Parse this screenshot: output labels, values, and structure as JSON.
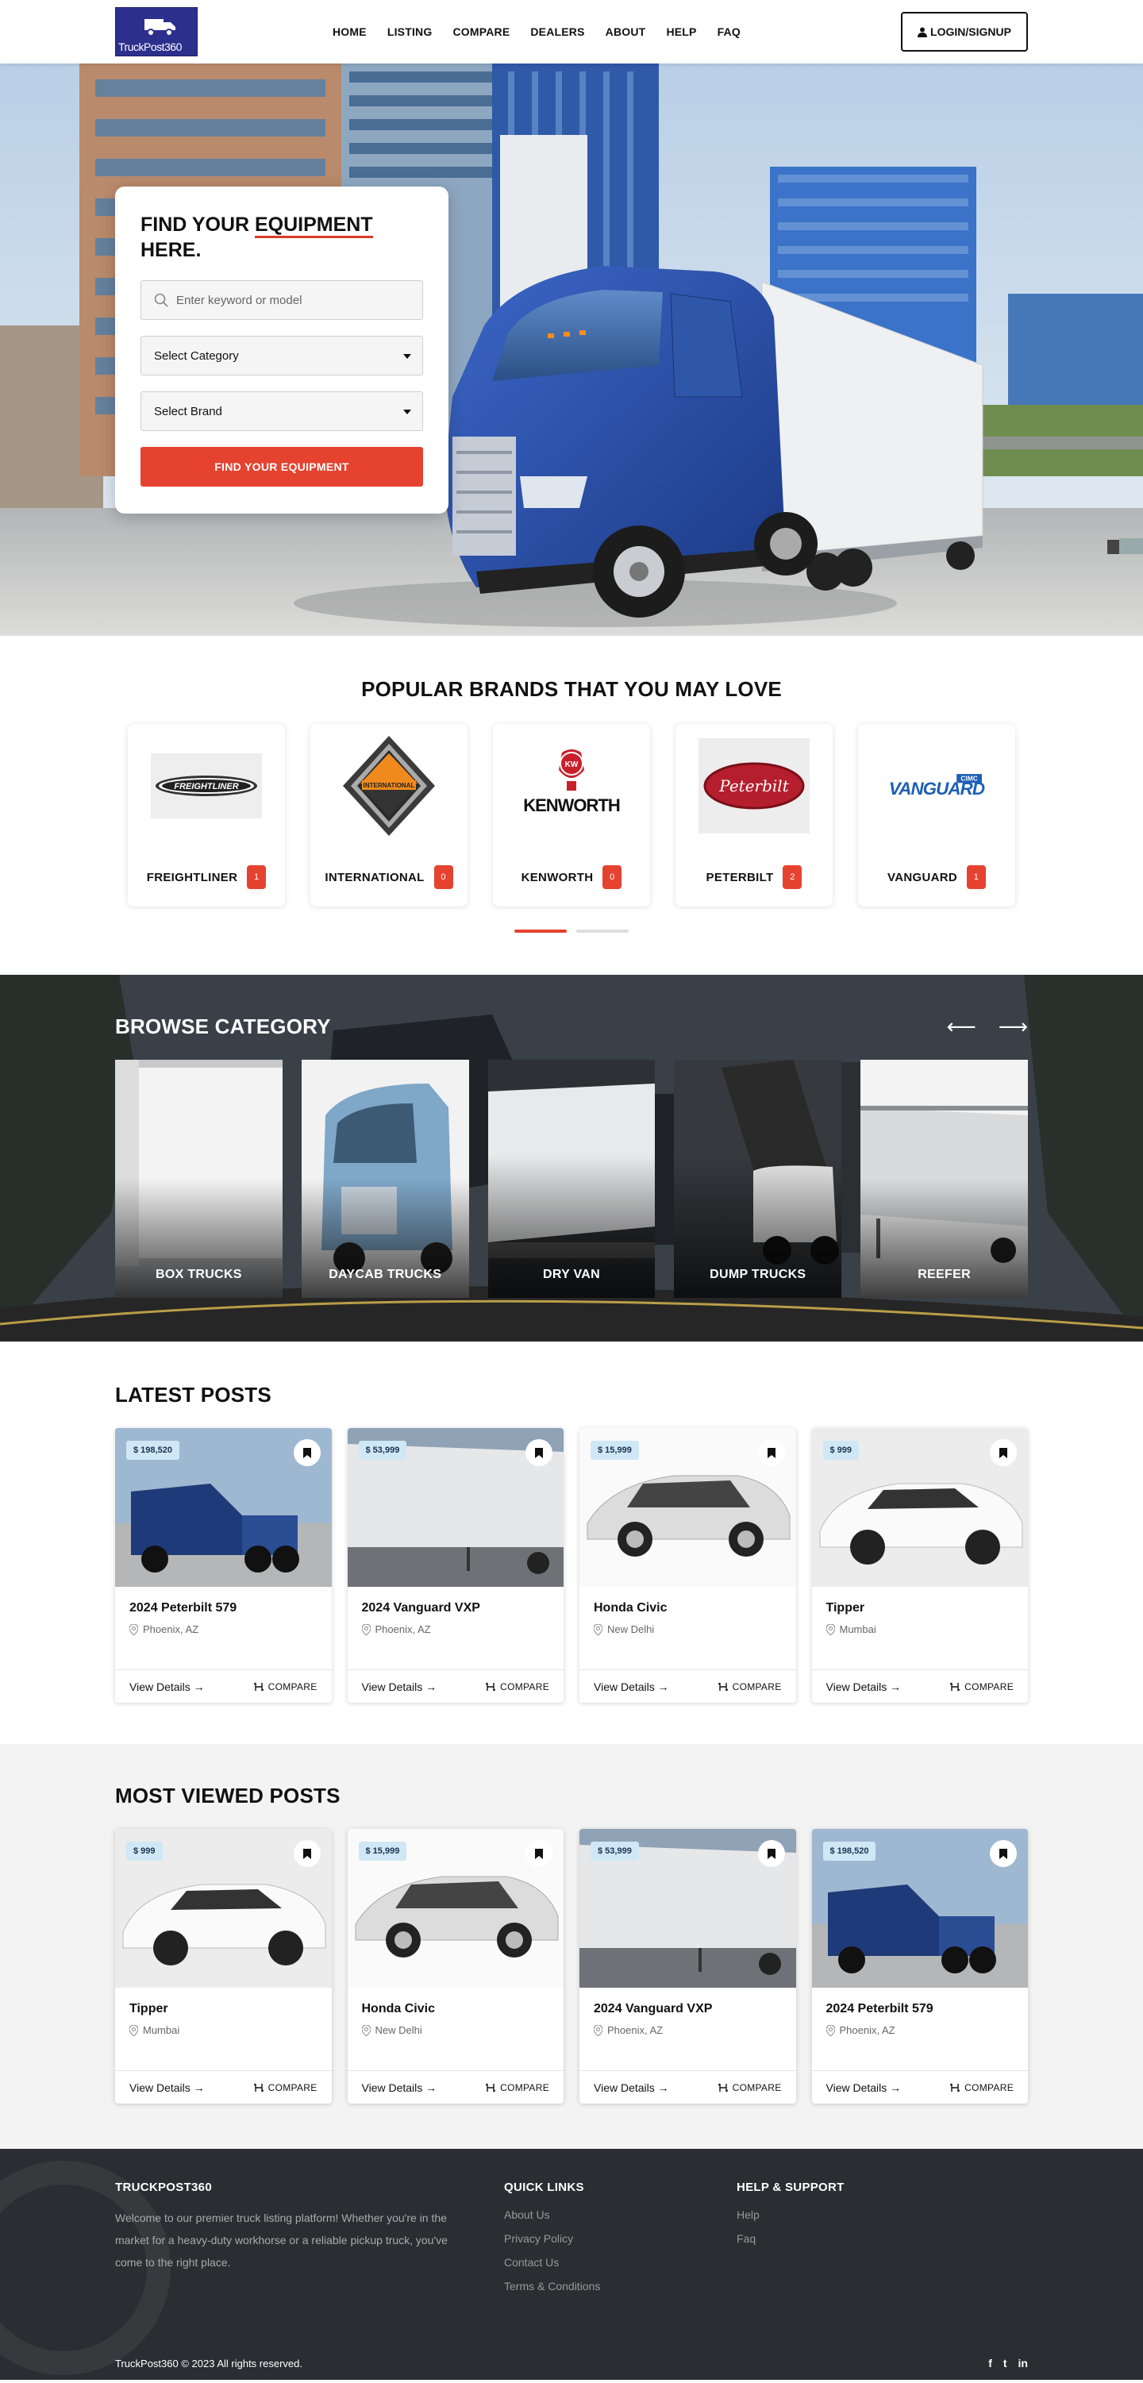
{
  "header": {
    "logo_text": "TruckPost360",
    "nav": [
      "HOME",
      "LISTING",
      "COMPARE",
      "DEALERS",
      "ABOUT",
      "HELP",
      "FAQ"
    ],
    "login_label": "LOGIN/SIGNUP"
  },
  "hero": {
    "title_part1": "FIND YOUR ",
    "title_highlight": "EQUIPMENT",
    "title_part2": "HERE.",
    "search_placeholder": "Enter keyword or model",
    "category_select": "Select Category",
    "brand_select": "Select Brand",
    "button": "FIND YOUR EQUIPMENT"
  },
  "brands": {
    "title": "POPULAR BRANDS THAT YOU MAY LOVE",
    "items": [
      {
        "name": "FREIGHTLINER",
        "count": "1"
      },
      {
        "name": "INTERNATIONAL",
        "count": "0"
      },
      {
        "name": "KENWORTH",
        "count": "0"
      },
      {
        "name": "PETERBILT",
        "count": "2"
      },
      {
        "name": "VANGUARD",
        "count": "1"
      }
    ],
    "logo_texts": {
      "freightliner": "FREIGHTLINER",
      "international": "INTERNATIONAL",
      "kenworth": "KENWORTH",
      "kenworth_badge": "KW",
      "peterbilt": "Peterbilt",
      "vanguard": "VANGUARD",
      "vanguard_small": "CIMC"
    }
  },
  "category": {
    "title": "BROWSE CATEGORY",
    "prev": "⟵",
    "next": "⟶",
    "items": [
      "BOX TRUCKS",
      "DAYCAB TRUCKS",
      "DRY VAN",
      "DUMP TRUCKS",
      "REEFER"
    ]
  },
  "latest": {
    "title": "LATEST POSTS",
    "items": [
      {
        "price": "$ 198,520",
        "title": "2024 Peterbilt 579",
        "location": "Phoenix, AZ"
      },
      {
        "price": "$ 53,999",
        "title": "2024 Vanguard VXP",
        "location": "Phoenix, AZ"
      },
      {
        "price": "$ 15,999",
        "title": "Honda Civic",
        "location": "New Delhi"
      },
      {
        "price": "$ 999",
        "title": "Tipper",
        "location": "Mumbai"
      }
    ]
  },
  "most_viewed": {
    "title": "MOST VIEWED POSTS",
    "items": [
      {
        "price": "$ 999",
        "title": "Tipper",
        "location": "Mumbai"
      },
      {
        "price": "$ 15,999",
        "title": "Honda Civic",
        "location": "New Delhi"
      },
      {
        "price": "$ 53,999",
        "title": "2024 Vanguard VXP",
        "location": "Phoenix, AZ"
      },
      {
        "price": "$ 198,520",
        "title": "2024 Peterbilt 579",
        "location": "Phoenix, AZ"
      }
    ]
  },
  "post_actions": {
    "view": "View Details →",
    "compare": "COMPARE"
  },
  "footer": {
    "brand_title": "TRUCKPOST360",
    "about": "Welcome to our premier truck listing platform! Whether you're in the market for a heavy-duty workhorse or a reliable pickup truck, you've come to the right place.",
    "quick_title": "QUICK LINKS",
    "quick_links": [
      "About Us",
      "Privacy Policy",
      "Contact Us",
      "Terms & Conditions"
    ],
    "help_title": "HELP & SUPPORT",
    "help_links": [
      "Help",
      "Faq"
    ],
    "copyright": "TruckPost360 © 2023 All rights reserved.",
    "social": [
      "f",
      "t",
      "in"
    ]
  },
  "colors": {
    "accent": "#e5422f",
    "dark": "#2a2d31",
    "navy": "#2d2f8c",
    "truck_blue": "#2b52b0"
  }
}
